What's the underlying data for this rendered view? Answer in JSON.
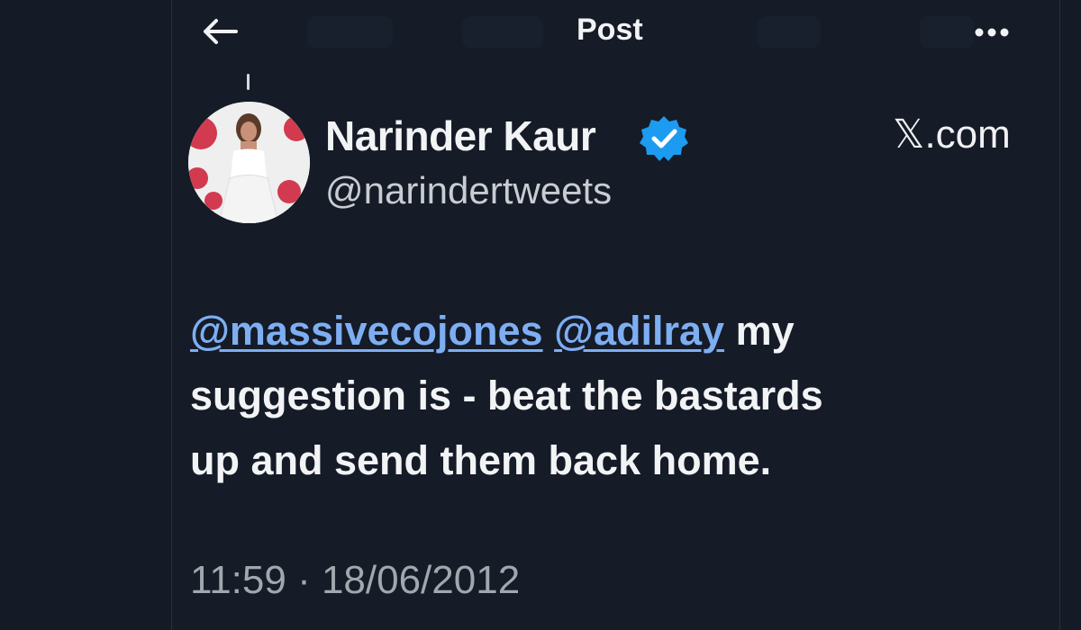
{
  "header": {
    "title": "Post",
    "back_icon": "arrow-left-icon",
    "more_icon": "more-horizontal-icon"
  },
  "author": {
    "name": "Narinder Kaur",
    "handle": "@narindertweets",
    "verified": true,
    "verified_icon": "verified-badge-icon",
    "avatar_icon": "user-avatar"
  },
  "source": "𝕏.com",
  "tweet": {
    "mention_1": "@massivecojones",
    "mention_2": "@adilray",
    "text_line_1": " my",
    "text_line_2": "suggestion is - beat the bastards",
    "text_line_3": "up and send them back home."
  },
  "timestamp": "11:59 · 18/06/2012",
  "colors": {
    "background": "#141a26",
    "text": "#f2f3f5",
    "mention": "#7eaef2",
    "muted": "#a2a7ae",
    "verified": "#1d9bf0"
  }
}
